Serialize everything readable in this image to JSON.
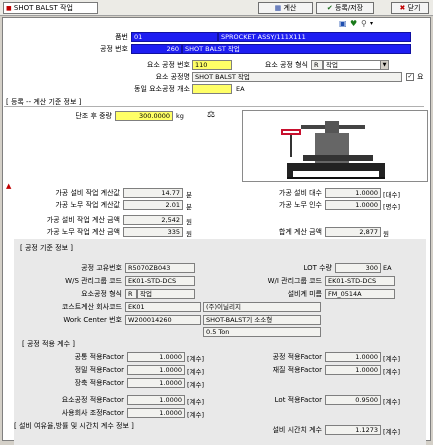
{
  "window": {
    "title": "SHOT BALST 작업"
  },
  "toolbar": {
    "calc": "계산",
    "register_save": "등록/저장",
    "close": "닫기"
  },
  "header": {
    "item_label": "품번",
    "item_code": "01",
    "item_name": "SPROCKET ASSY/111X111",
    "process_no_label": "공정 번호",
    "process_no": "260",
    "process_name": "SHOT BALST 작업",
    "elem_no_label": "요소 공정 번호",
    "elem_no": "110",
    "elem_type_label": "요소 공정 형식",
    "elem_type_code": "R",
    "elem_type_name": "작업",
    "elem_name_label": "요소 공정명",
    "elem_name": "SHOT BALST 작업",
    "same_count_label": "동일 요소공정 개소",
    "same_count_unit": "EA",
    "check_suffix": "요"
  },
  "register_section": {
    "title": "[ 등록 -- 계산 기준 정보 ]",
    "unit_weight_label": "단조 후 중량",
    "unit_weight": "300.0000",
    "unit_weight_unit": "kg"
  },
  "calc_rows": {
    "machine_time_label": "가공 설비 작업 계산값",
    "machine_time": "14.77",
    "machine_time_unit": "분",
    "labor_time_label": "가공 노무 작업 계산값",
    "labor_time": "2.01",
    "labor_time_unit": "분",
    "machine_count_label": "가공 설비 대수",
    "machine_count": "1.0000",
    "machine_count_unit": "[대수]",
    "labor_count_label": "가공 노무 인수",
    "labor_count": "1.0000",
    "labor_count_unit": "[명수]",
    "machine_amt_label": "가공 설비 작업 계산 금액",
    "machine_amt": "2,542",
    "machine_amt_unit": "원",
    "labor_amt_label": "가공 노무 작업 계산 금액",
    "labor_amt": "335",
    "labor_amt_unit": "원",
    "total_label": "합계 계산 금액",
    "total": "2,877",
    "total_unit": "원"
  },
  "process_section": {
    "title": "[ 공정 기준 정보 ]",
    "unique_no_label": "공정 고유번호",
    "unique_no": "R5070ZB043",
    "lot_label": "LOT 수량",
    "lot": "300",
    "lot_unit": "EA",
    "ws_code_label": "W/S 관리그룹 코드",
    "ws_code": "EK01-STD-DCS",
    "wi_code_label": "W/I 관리그룹 코드",
    "wi_code": "EK01-STD-DCS",
    "elem_form_label": "요소공정 형식",
    "elem_form_code": "R",
    "elem_form_name": "작업",
    "equip_label": "설비계 미름",
    "equip": "FM_0514A",
    "company_label": "코스트계산 회사코드",
    "company_code": "EK01",
    "company_name": "(주)이닐리지",
    "wc_label": "Work Center 번호",
    "wc_code": "W200014260",
    "wc_name": "SHOT-BALST기 소소형",
    "ton": "0.5 Ton"
  },
  "factor_section": {
    "title": "[ 공정 적용 계수 ]",
    "common_label": "공통 적용Factor",
    "common": "1.0000",
    "common_unit": "[계수]",
    "process_label": "공정 적용Factor",
    "process": "1.0000",
    "process_unit": "[계수]",
    "precision_label": "정밀 적용Factor",
    "precision": "1.0000",
    "precision_unit": "[계수]",
    "material_label": "재질 적용Factor",
    "material": "1.0000",
    "material_unit": "[계수]",
    "length_label": "장축 적용Factor",
    "length": "1.0000",
    "length_unit": "[계수]",
    "elem_label": "요소공정 적용Factor",
    "elem": "1.0000",
    "elem_unit": "[계수]",
    "lot_factor_label": "Lot 적용Factor",
    "lot_factor": "0.9500",
    "lot_factor_unit": "[계수]",
    "user_label": "사용회사 조정Factor",
    "user": "1.0000",
    "user_unit": "[계수]"
  },
  "bottom_section": {
    "title": "[ 설비 여유율,방률 및 시간치 계수 정보 ]",
    "time_label": "설비 시간치 계수",
    "time": "1.1273",
    "time_unit": "[계수]"
  },
  "colors": {
    "blue_field": "#1d1df2",
    "yellow_field": "#ffff66",
    "frame_bg": "#ffffff",
    "app_bg": "#d4d0c8"
  }
}
